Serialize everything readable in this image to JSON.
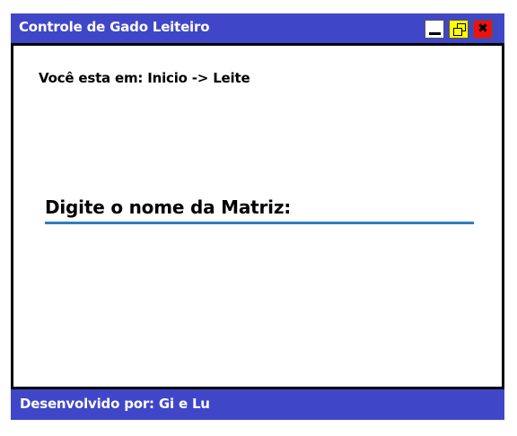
{
  "window": {
    "title": "Controle de Gado Leiteiro",
    "controls": {
      "minimize_icon": "minimize-icon",
      "maximize_icon": "restore-icon",
      "close_icon": "close-icon",
      "close_glyph": "✖"
    }
  },
  "breadcrumb": {
    "text": "Você esta em: Inicio -> Leite"
  },
  "form": {
    "matriz_label": "Digite o nome da Matriz:",
    "matriz_value": ""
  },
  "footer": {
    "text": "Desenvolvido por: Gi e Lu"
  },
  "colors": {
    "titlebar": "#3f47c8",
    "footer": "#3f47c8",
    "input_underline": "#2f7ec2",
    "maximize_button": "#ffff00",
    "close_button": "#ee1111"
  }
}
